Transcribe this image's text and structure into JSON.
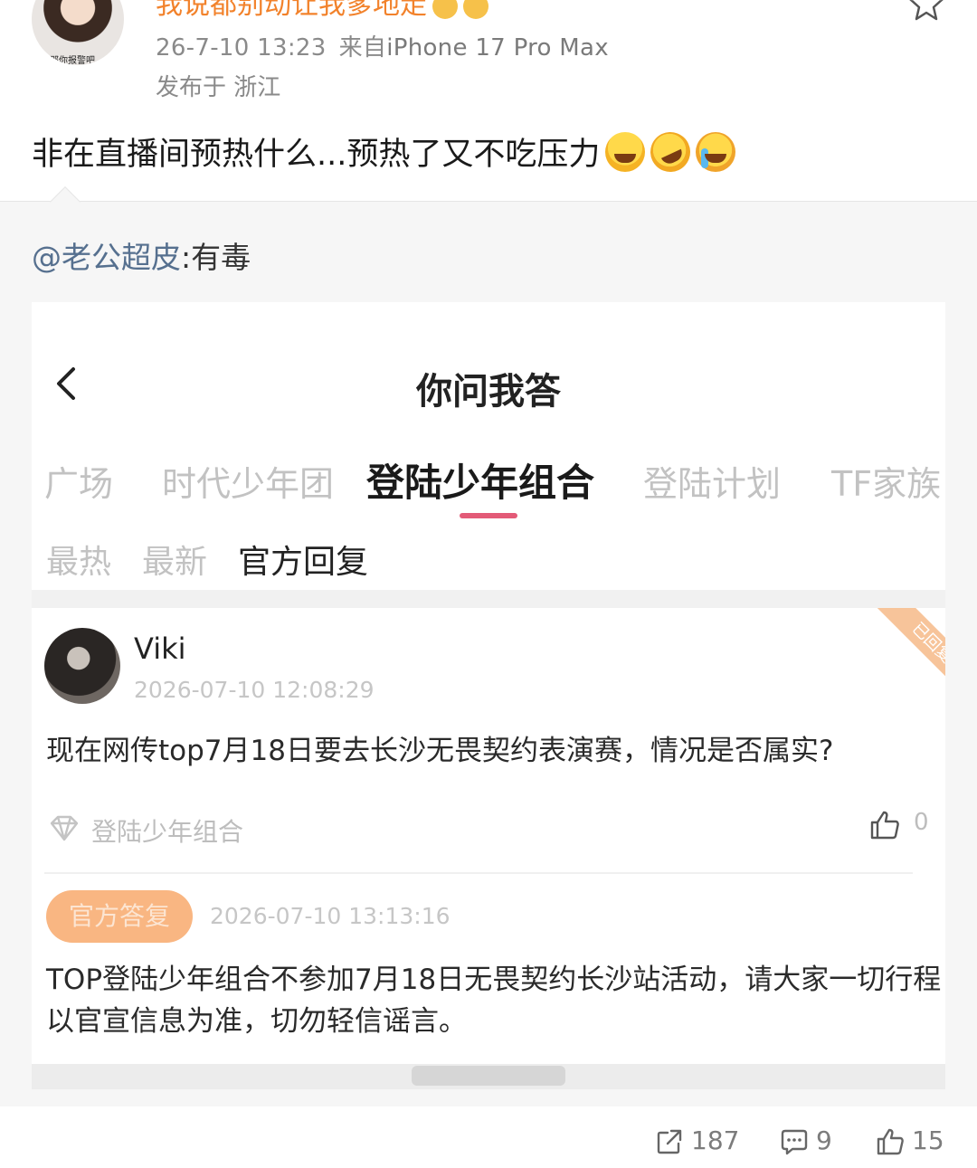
{
  "post": {
    "username": "我说都别动让我爹地走",
    "avatar_caption": "那你报警吧",
    "timestamp": "26-7-10 13:23",
    "source_prefix": "来自",
    "device": "iPhone 17 Pro Max",
    "location": "发布于 浙江",
    "text": "非在直播间预热什么...预热了又不吃压力",
    "emojis": [
      "laughing-emoji",
      "rolling-laughing-emoji",
      "crying-emoji"
    ]
  },
  "repost": {
    "mention": "@老公超皮",
    "text": ":有毒"
  },
  "embedded": {
    "title": "你问我答",
    "tabs": [
      "广场",
      "时代少年团",
      "登陆少年组合",
      "登陆计划",
      "TF家族"
    ],
    "active_tab": "登陆少年组合",
    "subtabs": [
      "最热",
      "最新",
      "官方回复"
    ],
    "active_subtab": "官方回复",
    "corner_ribbon": "已回复",
    "question": {
      "author": "Viki",
      "time": "2026-07-10 12:08:29",
      "text": "现在网传top7月18日要去长沙无畏契约表演赛，情况是否属实?",
      "tag": "登陆少年组合",
      "likes": "0"
    },
    "reply": {
      "badge": "官方答复",
      "time": "2026-07-10 13:13:16",
      "text": "TOP登陆少年组合不参加7月18日无畏契约长沙站活动，请大家一切行程以官宣信息为准，切勿轻信谣言。"
    }
  },
  "actions": {
    "reposts": "187",
    "comments": "9",
    "likes": "15"
  },
  "colors": {
    "username": "#f2822b",
    "mention": "#56708f",
    "tab_indicator": "#e35a77",
    "official_badge": "#f9b682"
  }
}
